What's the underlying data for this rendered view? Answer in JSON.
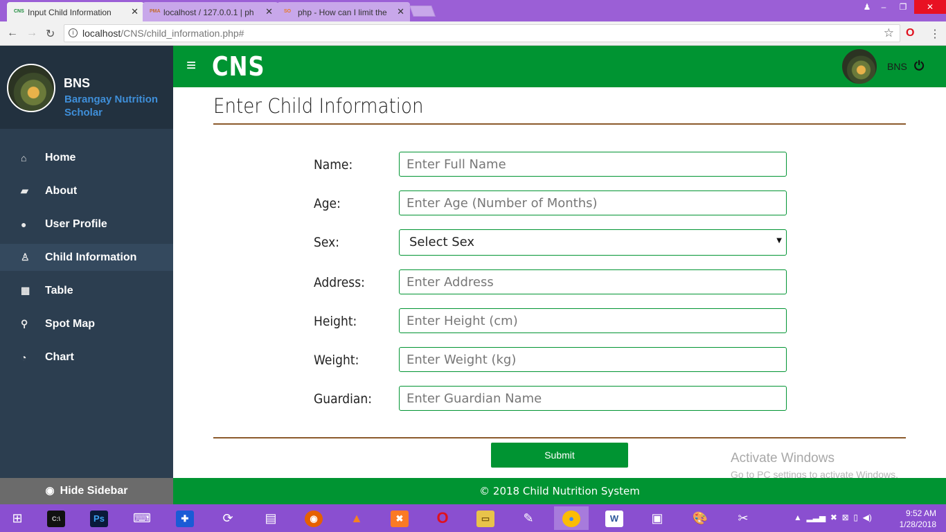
{
  "browser": {
    "tabs": [
      {
        "favicon": "CNS",
        "title": "Input Child Information"
      },
      {
        "favicon": "PMA",
        "title": "localhost / 127.0.0.1 | ph"
      },
      {
        "favicon": "SO",
        "title": "php - How can I limit the"
      }
    ],
    "url_host": "localhost",
    "url_path": "/CNS/child_information.php#"
  },
  "sidebar": {
    "title": "BNS",
    "subtitle": "Barangay Nutrition Scholar",
    "items": [
      {
        "label": "Home",
        "icon": "home-icon",
        "glyph": "⌂"
      },
      {
        "label": "About",
        "icon": "book-icon",
        "glyph": "▰"
      },
      {
        "label": "User Profile",
        "icon": "user-icon",
        "glyph": "●"
      },
      {
        "label": "Child Information",
        "icon": "child-icon",
        "glyph": "♙"
      },
      {
        "label": "Table",
        "icon": "table-icon",
        "glyph": "▦"
      },
      {
        "label": "Spot Map",
        "icon": "map-marker-icon",
        "glyph": "⚲"
      },
      {
        "label": "Chart",
        "icon": "pie-chart-icon",
        "glyph": "◔"
      }
    ],
    "active_item": "Child Information",
    "hide_label": "Hide Sidebar"
  },
  "topbar": {
    "brand": "CNS",
    "user": "BNS"
  },
  "main": {
    "title": "Enter Child Information",
    "fields": [
      {
        "label": "Name:",
        "placeholder": "Enter Full Name"
      },
      {
        "label": "Age:",
        "placeholder": "Enter Age (Number of Months)"
      },
      {
        "label": "Sex:",
        "value": "Select Sex"
      },
      {
        "label": "Address:",
        "placeholder": "Enter Address"
      },
      {
        "label": "Height:",
        "placeholder": "Enter Height (cm)"
      },
      {
        "label": "Weight:",
        "placeholder": "Enter Weight (kg)"
      },
      {
        "label": "Guardian:",
        "placeholder": "Enter Guardian Name"
      }
    ],
    "submit": "Submit",
    "watermark_title": "Activate Windows",
    "watermark_sub": "Go to PC settings to activate Windows."
  },
  "footer": {
    "text": "© 2018 Child Nutrition System"
  },
  "taskbar": {
    "time": "9:52 AM",
    "date": "1/28/2018"
  }
}
